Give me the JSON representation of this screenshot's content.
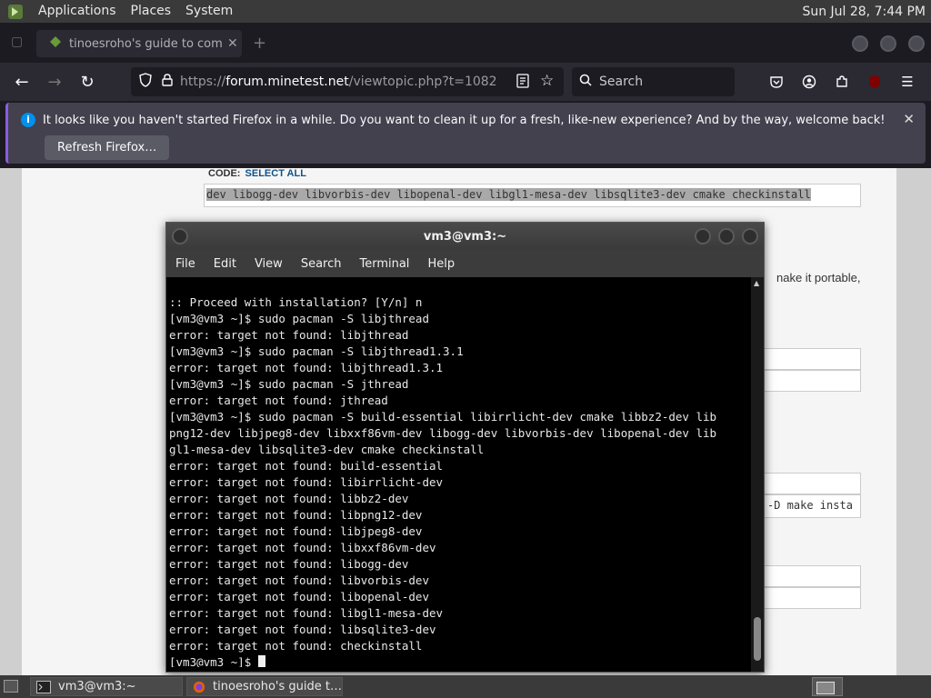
{
  "top_panel": {
    "applications": "Applications",
    "places": "Places",
    "system": "System",
    "clock": "Sun Jul 28,  7:44 PM"
  },
  "browser": {
    "tab_title": "tinoesroho's guide to comp",
    "url_domain": "forum.minetest.net",
    "url_prefix": "https://",
    "url_path": "/viewtopic.php?t=1082",
    "search_placeholder": "Search",
    "notification": {
      "message": "It looks like you haven't started Firefox in a while. Do you want to clean it up for a fresh, like-new experience? And by the way, welcome back!",
      "refresh_button": "Refresh Firefox…"
    },
    "page": {
      "code_label": "CODE:",
      "select_all": "SELECT ALL",
      "code_line": "dev libogg-dev libvorbis-dev libopenal-dev libgl1-mesa-dev libsqlite3-dev cmake checkinstall",
      "portable_text": "nake it portable,",
      "make_install_text": "-D make insta"
    }
  },
  "terminal": {
    "title": "vm3@vm3:~",
    "menu": [
      "File",
      "Edit",
      "View",
      "Search",
      "Terminal",
      "Help"
    ],
    "lines": [
      ":: Proceed with installation? [Y/n] n",
      "[vm3@vm3 ~]$ sudo pacman -S libjthread",
      "error: target not found: libjthread",
      "[vm3@vm3 ~]$ sudo pacman -S libjthread1.3.1",
      "error: target not found: libjthread1.3.1",
      "[vm3@vm3 ~]$ sudo pacman -S jthread",
      "error: target not found: jthread",
      "[vm3@vm3 ~]$ sudo pacman -S build-essential libirrlicht-dev cmake libbz2-dev lib",
      "png12-dev libjpeg8-dev libxxf86vm-dev libogg-dev libvorbis-dev libopenal-dev lib",
      "gl1-mesa-dev libsqlite3-dev cmake checkinstall",
      "error: target not found: build-essential",
      "error: target not found: libirrlicht-dev",
      "error: target not found: libbz2-dev",
      "error: target not found: libpng12-dev",
      "error: target not found: libjpeg8-dev",
      "error: target not found: libxxf86vm-dev",
      "error: target not found: libogg-dev",
      "error: target not found: libvorbis-dev",
      "error: target not found: libopenal-dev",
      "error: target not found: libgl1-mesa-dev",
      "error: target not found: libsqlite3-dev",
      "error: target not found: checkinstall"
    ],
    "prompt": "[vm3@vm3 ~]$ "
  },
  "taskbar": {
    "terminal_task": "vm3@vm3:~",
    "firefox_task": "tinoesroho's guide t…"
  }
}
